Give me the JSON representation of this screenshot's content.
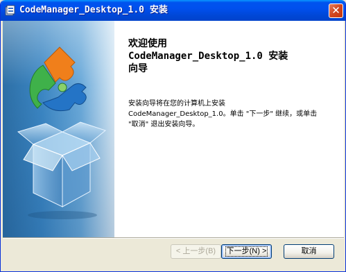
{
  "window": {
    "title": "CodeManager_Desktop_1.0 安装",
    "close_symbol": "✕"
  },
  "welcome": {
    "heading": "欢迎使用\nCodeManager_Desktop_1.0 安装\n向导",
    "description": "安装向导将在您的计算机上安装\nCodeManager_Desktop_1.0。单击 \"下一步\" 继续，或单击\n\"取消\" 退出安装向导。"
  },
  "buttons": {
    "back": "< 上一步(B)",
    "next": "下一步(N) >",
    "cancel": "取消"
  },
  "icons": {
    "title": "installer-icon",
    "side": "box-puzzle-icon"
  },
  "colors": {
    "titlebar": "#0054e3",
    "side_panel": "#3b86c3",
    "close_button": "#d1461e"
  }
}
